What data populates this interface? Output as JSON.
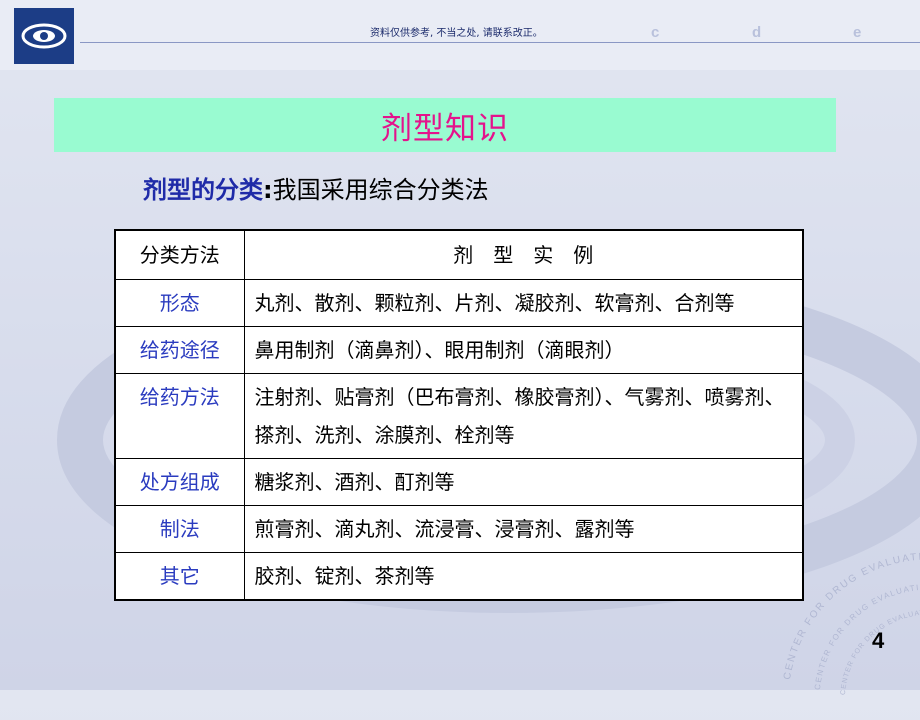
{
  "header": {
    "notice": "资料仅供参考, 不当之处, 请联系改正。",
    "letters": [
      "c",
      "d",
      "e"
    ]
  },
  "title": "剂型知识",
  "subtitle": {
    "lead": "剂型的分类",
    "colon": ":",
    "rest": "我国采用综合分类法"
  },
  "table": {
    "headers": [
      "分类方法",
      "剂　型　实　例"
    ],
    "rows": [
      {
        "category": "形态",
        "examples": "丸剂、散剂、颗粒剂、片剂、凝胶剂、软膏剂、合剂等"
      },
      {
        "category": "给药途径",
        "examples": "鼻用制剂（滴鼻剂）、眼用制剂（滴眼剂）"
      },
      {
        "category": "给药方法",
        "examples": "注射剂、贴膏剂（巴布膏剂、橡胶膏剂）、气雾剂、喷雾剂、搽剂、洗剂、涂膜剂、栓剂等"
      },
      {
        "category": "处方组成",
        "examples": "糖浆剂、酒剂、酊剂等"
      },
      {
        "category": "制法",
        "examples": "煎膏剂、滴丸剂、流浸膏、浸膏剂、露剂等"
      },
      {
        "category": "其它",
        "examples": "胶剂、锭剂、茶剂等"
      }
    ]
  },
  "watermark_text": [
    "CENTER FOR DRUG EVALUATION",
    "CENTER FOR DRUG EVALUATION",
    "CENTER FOR DRUG EVALUATION"
  ],
  "page_number": "4",
  "colors": {
    "title_box": "#99fbd1",
    "title_text": "#e4138c",
    "category_text": "#2a3bbf",
    "logo": "#1c3d86"
  }
}
